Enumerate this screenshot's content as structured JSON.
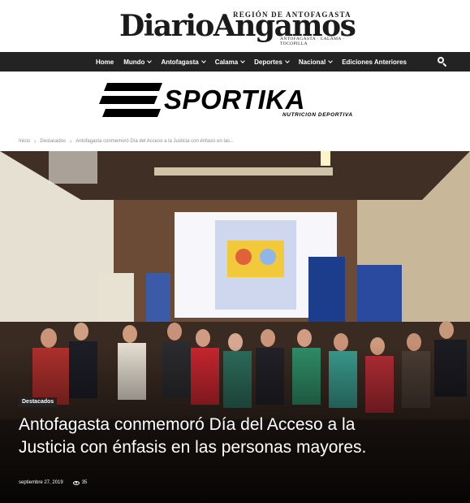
{
  "header": {
    "logo_name": "DiarioAngamos",
    "logo_region": "REGIÓN DE ANTOFAGASTA",
    "logo_cities": "ANTOFAGASTA · CALAMA · TOCOPILLA"
  },
  "nav": {
    "items": [
      {
        "label": "Home",
        "dropdown": false
      },
      {
        "label": "Mundo",
        "dropdown": true
      },
      {
        "label": "Antofagasta",
        "dropdown": true
      },
      {
        "label": "Calama",
        "dropdown": true
      },
      {
        "label": "Deportes",
        "dropdown": true
      },
      {
        "label": "Nacional",
        "dropdown": true
      },
      {
        "label": "Ediciones Anteriores",
        "dropdown": false
      }
    ],
    "search_icon": "search-icon"
  },
  "ad": {
    "brand": "SPORTIKA",
    "tagline": "NUTRICION DEPORTIVA"
  },
  "breadcrumb": [
    "Inicio",
    "Destacados",
    "Antofagasta conmemoró Día del Acceso a la Justicia con énfasis en las..."
  ],
  "article": {
    "category": "Destacados",
    "title": "Antofagasta conmemoró Día del Acceso a la Justicia con énfasis en las personas mayores.",
    "date": "septiembre 27, 2019",
    "views": "35"
  },
  "colors": {
    "navbar": "#232323",
    "breadcrumb_text": "#8a8a8a"
  }
}
